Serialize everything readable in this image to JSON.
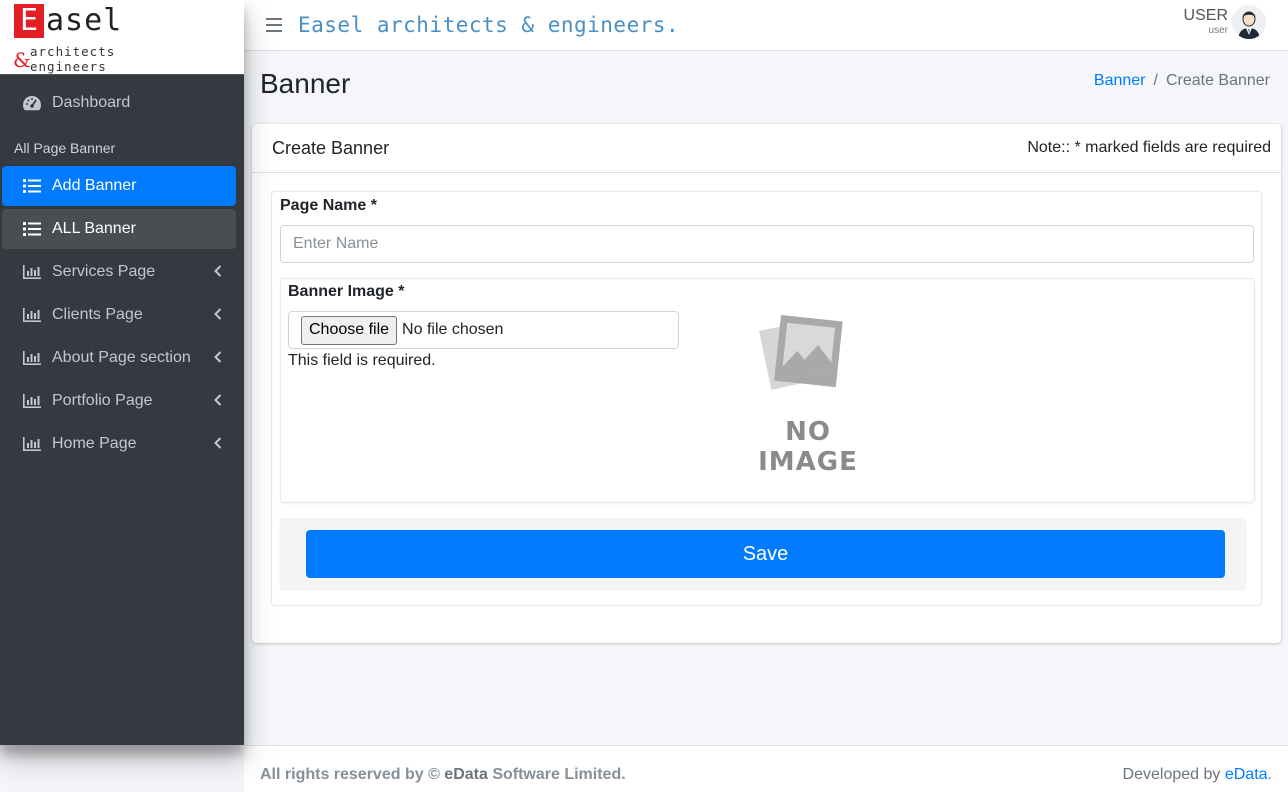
{
  "brand": {
    "logo_letter": "E",
    "logo_rest": "asel",
    "logo_amp": "&",
    "logo_line1": "architects",
    "logo_line2": "engineers"
  },
  "topbar": {
    "site_title": "Easel architects & engineers.",
    "user_name": "USER",
    "user_role": "user"
  },
  "sidebar": {
    "dashboard": {
      "label": "Dashboard",
      "icon": "tachometer-icon"
    },
    "section_header": "All Page Banner",
    "items": [
      {
        "label": "Add Banner",
        "icon": "list-icon",
        "state": "active"
      },
      {
        "label": "ALL Banner",
        "icon": "list-icon",
        "state": "selected"
      },
      {
        "label": "Services Page",
        "icon": "chart-bar-icon",
        "has_submenu": true
      },
      {
        "label": "Clients Page",
        "icon": "chart-bar-icon",
        "has_submenu": true
      },
      {
        "label": "About Page section",
        "icon": "chart-bar-icon",
        "has_submenu": true
      },
      {
        "label": "Portfolio Page",
        "icon": "chart-bar-icon",
        "has_submenu": true
      },
      {
        "label": "Home Page",
        "icon": "chart-bar-icon",
        "has_submenu": true
      }
    ]
  },
  "content": {
    "page_title": "Banner",
    "breadcrumb": {
      "link": "Banner",
      "sep": "/",
      "current": "Create Banner"
    }
  },
  "card": {
    "title": "Create Banner",
    "note": "Note:: * marked fields are required",
    "page_name_label": "Page Name *",
    "page_name_placeholder": "Enter Name",
    "page_name_value": "",
    "banner_image_label": "Banner Image *",
    "file_button": "Choose file",
    "file_status": "No file chosen",
    "error_text": "This field is required.",
    "no_image_text": "NO IMAGE",
    "save_label": "Save"
  },
  "footer": {
    "left_prefix": "All rights reserved by © ",
    "left_brand": "eData",
    "left_suffix": " Software Limited.",
    "right_prefix": "Developed by ",
    "right_link": "eData",
    "right_suffix": "."
  },
  "colors": {
    "sidebar_bg": "#343a40",
    "accent": "#007bff",
    "logo_red": "#e31e24",
    "title_blue": "#4a90c8"
  }
}
